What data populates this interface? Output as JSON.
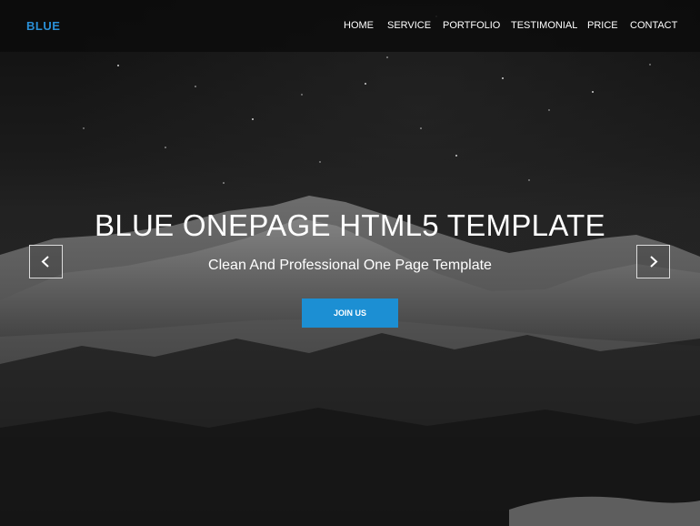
{
  "brand": {
    "name": "BLUE",
    "color": "#2a8fd6"
  },
  "nav": {
    "items": [
      {
        "label": "HOME"
      },
      {
        "label": "SERVICE"
      },
      {
        "label": "PORTFOLIO"
      },
      {
        "label": "TESTIMONIAL"
      },
      {
        "label": "PRICE"
      },
      {
        "label": "CONTACT"
      }
    ]
  },
  "hero": {
    "title": "BLUE ONEPAGE HTML5 TEMPLATE",
    "subtitle": "Clean And Professional One Page Template",
    "cta_label": "JOIN US",
    "cta_color": "#1c8fd3",
    "prev_icon": "chevron-left-icon",
    "next_icon": "chevron-right-icon"
  }
}
